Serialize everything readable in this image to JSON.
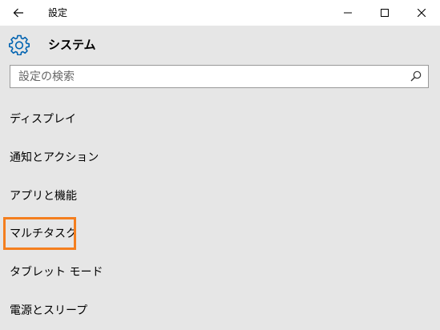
{
  "window": {
    "title": "設定"
  },
  "icons": {
    "back": "back-arrow-icon",
    "minimize": "minimize-icon",
    "maximize": "maximize-icon",
    "close": "close-icon",
    "gear": "gear-icon",
    "search": "search-icon"
  },
  "header": {
    "title": "システム"
  },
  "search": {
    "placeholder": "設定の検索",
    "value": ""
  },
  "menu": {
    "items": [
      {
        "label": "ディスプレイ"
      },
      {
        "label": "通知とアクション"
      },
      {
        "label": "アプリと機能"
      },
      {
        "label": "マルチタスク",
        "highlighted": true
      },
      {
        "label": "タブレット モード"
      },
      {
        "label": "電源とスリープ"
      }
    ]
  },
  "colors": {
    "accent": "#0063b1",
    "highlight": "#f47e1e",
    "background": "#e6e6e6",
    "titlebar": "#ffffff"
  }
}
